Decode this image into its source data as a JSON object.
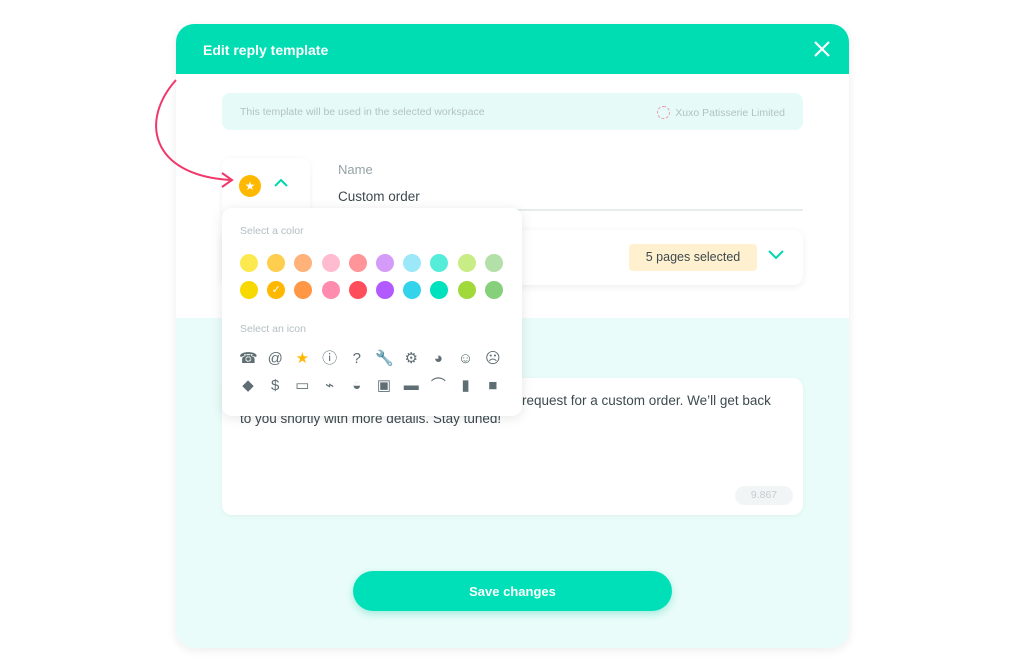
{
  "modal": {
    "title": "Edit reply template",
    "close_icon": "close-icon"
  },
  "info": {
    "text": "This template will be used in the selected workspace",
    "workspace": "Xuxo Patisserie Limited"
  },
  "name": {
    "label": "Name",
    "value": "Custom order"
  },
  "pages": {
    "badge": "5 pages selected"
  },
  "message": {
    "line1": "request for a custom order. We’ll get back",
    "line2": "to you shortly with more details. Stay tuned!",
    "counter": "9.867"
  },
  "save_label": "Save changes",
  "picker": {
    "color_label": "Select a color",
    "icon_label": "Select an icon",
    "selected_color": "#FFB800",
    "selected_icon": "star",
    "colors": [
      "#FCE94F",
      "#FFCE4F",
      "#FFB27A",
      "#FFBCD0",
      "#FF9599",
      "#D59BF9",
      "#9CE8F8",
      "#55EDD9",
      "#C8EC86",
      "#B2E0A8",
      "#F7D900",
      "#FFB800",
      "#FF9745",
      "#FF8CAE",
      "#FF4E5B",
      "#B259FF",
      "#33D3EC",
      "#00E1BE",
      "#A2D93A",
      "#86D07B"
    ],
    "check": "✓",
    "icons": [
      {
        "name": "phone",
        "glyph": "☎"
      },
      {
        "name": "at",
        "glyph": "@"
      },
      {
        "name": "star",
        "glyph": "★"
      },
      {
        "name": "info",
        "glyph": "ⓘ"
      },
      {
        "name": "question",
        "glyph": "?"
      },
      {
        "name": "wrench",
        "glyph": "🔧"
      },
      {
        "name": "gear",
        "glyph": "⚙"
      },
      {
        "name": "globe",
        "glyph": "◕"
      },
      {
        "name": "smile",
        "glyph": "☺"
      },
      {
        "name": "frown",
        "glyph": "☹"
      },
      {
        "name": "tag",
        "glyph": "◆"
      },
      {
        "name": "dollar",
        "glyph": "$"
      },
      {
        "name": "credit-card",
        "glyph": "▭"
      },
      {
        "name": "cart",
        "glyph": "⌁"
      },
      {
        "name": "basket",
        "glyph": "◒"
      },
      {
        "name": "package",
        "glyph": "▣"
      },
      {
        "name": "truck",
        "glyph": "▬"
      },
      {
        "name": "paperclip",
        "glyph": "⌒"
      },
      {
        "name": "file",
        "glyph": "▮"
      },
      {
        "name": "briefcase",
        "glyph": "■"
      }
    ]
  },
  "colors": {
    "accent": "#00DDB3",
    "arrow": "#F0386B"
  }
}
